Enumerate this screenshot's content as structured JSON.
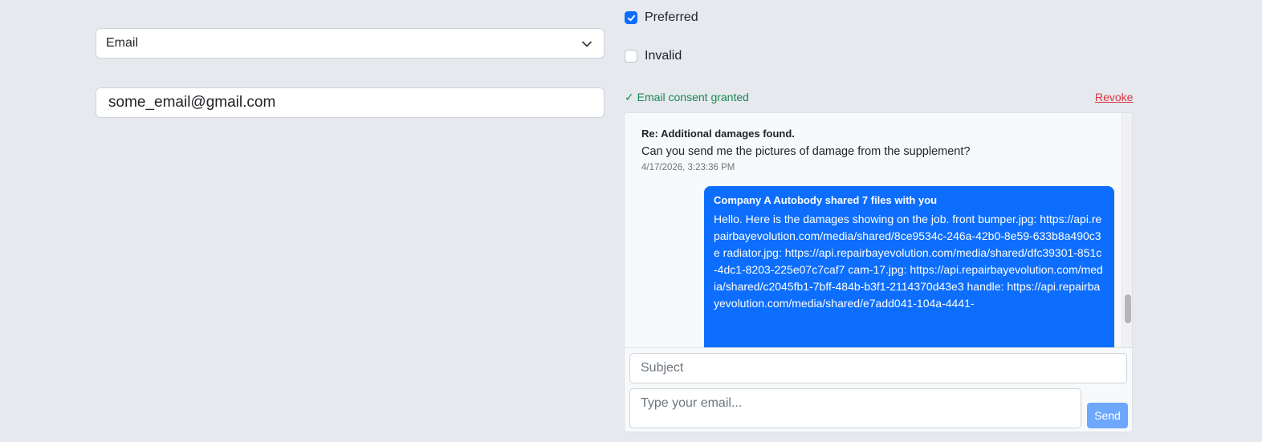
{
  "channel_select": {
    "value": "Email",
    "icon": "chevron-down-icon"
  },
  "email_address": {
    "value": "some_email@gmail.com"
  },
  "flags": {
    "preferred": {
      "label": "Preferred",
      "checked": true
    },
    "invalid": {
      "label": "Invalid",
      "checked": false
    }
  },
  "consent": {
    "text": "✓ Email consent granted",
    "revoke_label": "Revoke",
    "color": "#198754"
  },
  "thread": {
    "incoming": {
      "subject": "Re: Additional damages found.",
      "body": "Can you send me the pictures of damage from the supplement?",
      "timestamp": "4/17/2026, 3:23:36 PM"
    },
    "outgoing": {
      "subject": "Company A Autobody shared 7 files with you",
      "body": "Hello. Here is the damages showing on the job. front bumper.jpg: https://api.repairbayevolution.com/media/shared/8ce9534c-246a-42b0-8e59-633b8a490c3e radiator.jpg: https://api.repairbayevolution.com/media/shared/dfc39301-851c-4dc1-8203-225e07c7caf7 cam-17.jpg: https://api.repairbayevolution.com/media/shared/c2045fb1-7bff-484b-b3f1-2114370d43e3 handle: https://api.repairbayevolution.com/media/shared/e7add041-104a-4441-",
      "color": "#0d6efd"
    }
  },
  "compose": {
    "subject_placeholder": "Subject",
    "body_placeholder": "Type your email...",
    "send_label": "Send"
  }
}
